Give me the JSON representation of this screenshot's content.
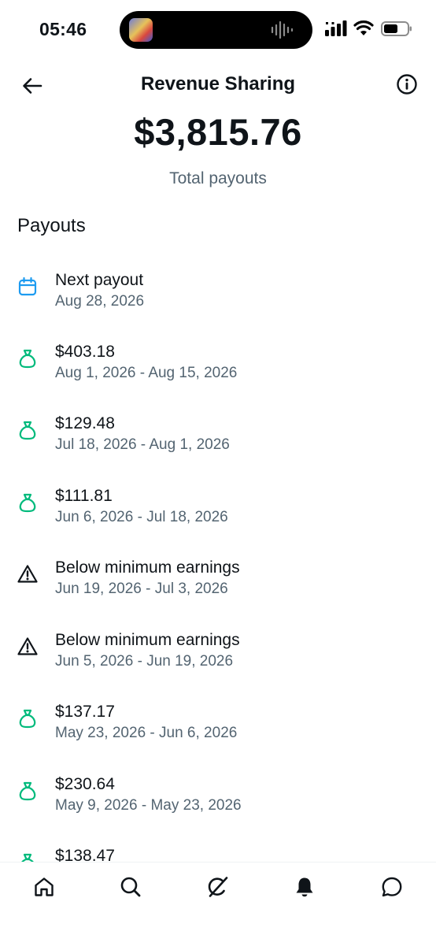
{
  "status_bar": {
    "time": "05:46"
  },
  "header": {
    "title": "Revenue Sharing"
  },
  "summary": {
    "total_amount": "$3,815.76",
    "total_label": "Total payouts"
  },
  "section": {
    "title": "Payouts"
  },
  "payouts": [
    {
      "icon": "calendar-icon",
      "primary": "Next payout",
      "secondary": "Aug 28, 2026"
    },
    {
      "icon": "money-bag-icon",
      "primary": "$403.18",
      "secondary": "Aug 1, 2026 - Aug 15, 2026"
    },
    {
      "icon": "money-bag-icon",
      "primary": "$129.48",
      "secondary": "Jul 18, 2026 - Aug 1, 2026"
    },
    {
      "icon": "money-bag-icon",
      "primary": "$111.81",
      "secondary": "Jun 6, 2026 - Jul 18, 2026"
    },
    {
      "icon": "warning-icon",
      "primary": "Below minimum earnings",
      "secondary": "Jun 19, 2026 - Jul 3, 2026"
    },
    {
      "icon": "warning-icon",
      "primary": "Below minimum earnings",
      "secondary": "Jun 5, 2026 - Jun 19, 2026"
    },
    {
      "icon": "money-bag-icon",
      "primary": "$137.17",
      "secondary": "May 23, 2026 - Jun 6, 2026"
    },
    {
      "icon": "money-bag-icon",
      "primary": "$230.64",
      "secondary": "May 9, 2026 - May 23, 2026"
    },
    {
      "icon": "money-bag-icon",
      "primary": "$138.47",
      "secondary": ""
    }
  ],
  "nav": [
    "home-icon",
    "search-icon",
    "grok-icon",
    "notifications-icon",
    "messages-icon"
  ],
  "colors": {
    "money": "#00ba7c",
    "calendar": "#1d9bf0",
    "text": "#0f1419",
    "secondary": "#536471"
  }
}
